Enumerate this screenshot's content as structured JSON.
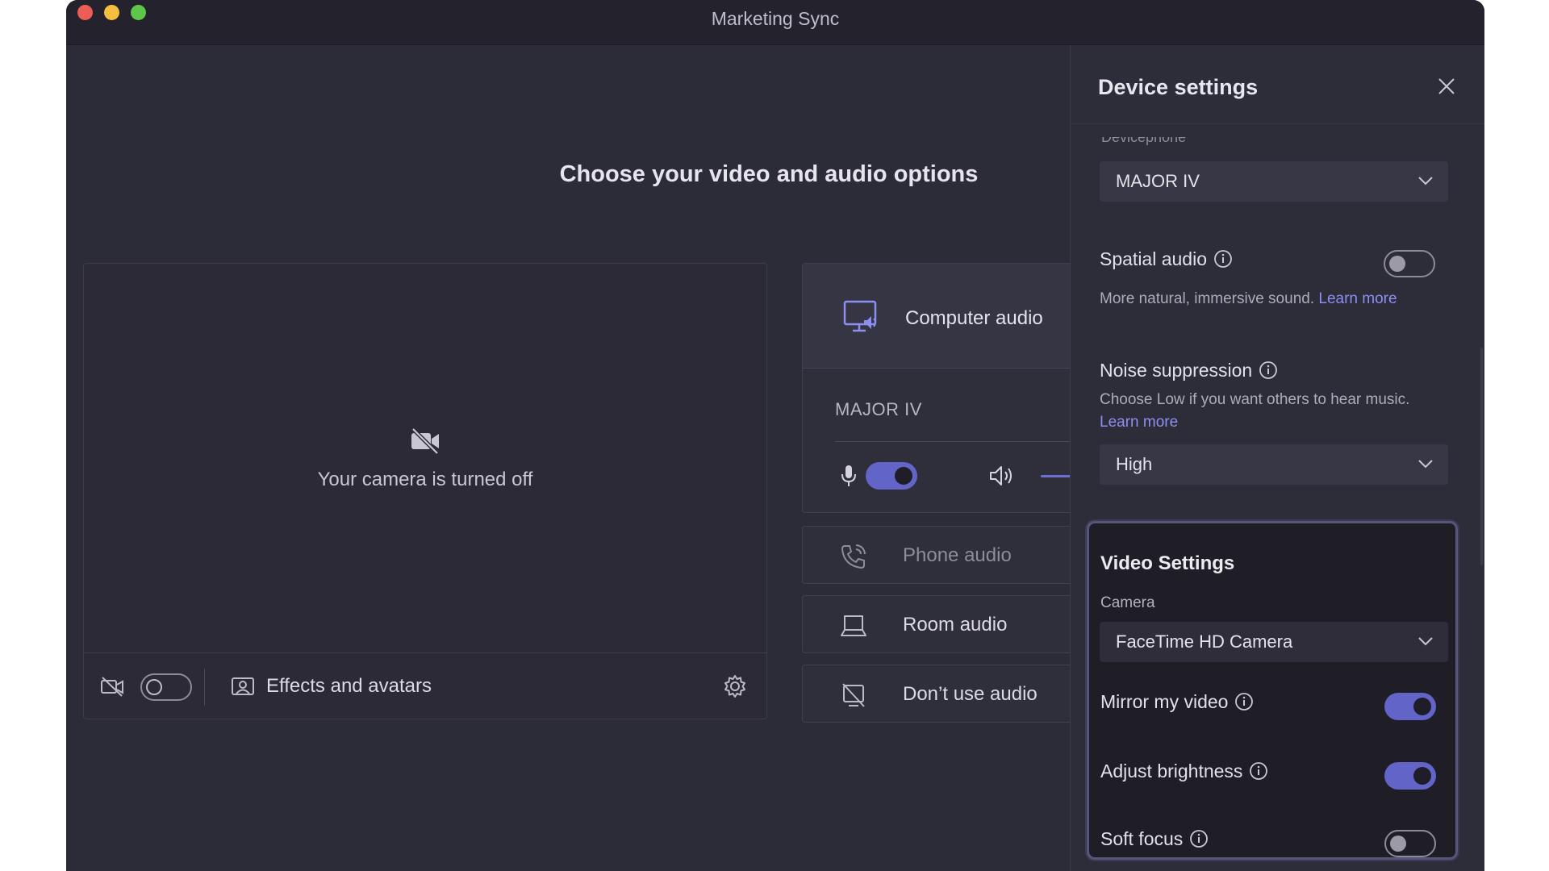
{
  "window": {
    "title": "Marketing Sync"
  },
  "main": {
    "heading": "Choose your video and audio options",
    "camera_off_text": "Your camera is turned off",
    "effects_label": "Effects and avatars"
  },
  "audio": {
    "computer_audio_label": "Computer audio",
    "device_name": "MAJOR IV",
    "mic_enabled": true,
    "phone_audio_label": "Phone audio",
    "room_audio_label": "Room audio",
    "no_audio_label": "Don’t use audio"
  },
  "panel": {
    "title": "Device settings",
    "cut_off_label": "Devicephone",
    "speaker_select_value": "MAJOR IV",
    "spatial_audio": {
      "label": "Spatial audio",
      "enabled": false,
      "desc": "More natural, immersive sound.",
      "link": "Learn more"
    },
    "noise_suppression": {
      "label": "Noise suppression",
      "desc": "Choose Low if you want others to hear music.",
      "link": "Learn more",
      "value": "High"
    },
    "video_settings": {
      "title": "Video Settings",
      "camera_label": "Camera",
      "camera_value": "FaceTime HD Camera",
      "mirror": {
        "label": "Mirror my video",
        "enabled": true
      },
      "brightness": {
        "label": "Adjust brightness",
        "enabled": true
      },
      "soft_focus": {
        "label": "Soft focus",
        "enabled": false
      }
    }
  },
  "colors": {
    "accent": "#6264c8",
    "link": "#8d8ff0",
    "window_bg": "#2c2b38"
  }
}
